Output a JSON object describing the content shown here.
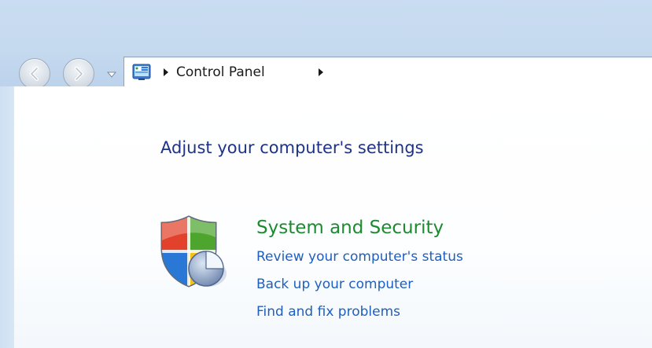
{
  "address_bar": {
    "breadcrumbs": [
      "Control Panel"
    ],
    "icon": "control-panel-icon"
  },
  "nav": {
    "back_icon": "back-arrow-icon",
    "forward_icon": "forward-arrow-icon",
    "recent_icon": "chevron-down-icon"
  },
  "main": {
    "title": "Adjust your computer's settings",
    "categories": [
      {
        "title": "System and Security",
        "icon": "shield-security-icon",
        "links": [
          "Review your computer's status",
          "Back up your computer",
          "Find and fix problems"
        ]
      }
    ]
  },
  "colors": {
    "title": "#1e3287",
    "category": "#1e8a2f",
    "link": "#1e5fbf"
  }
}
